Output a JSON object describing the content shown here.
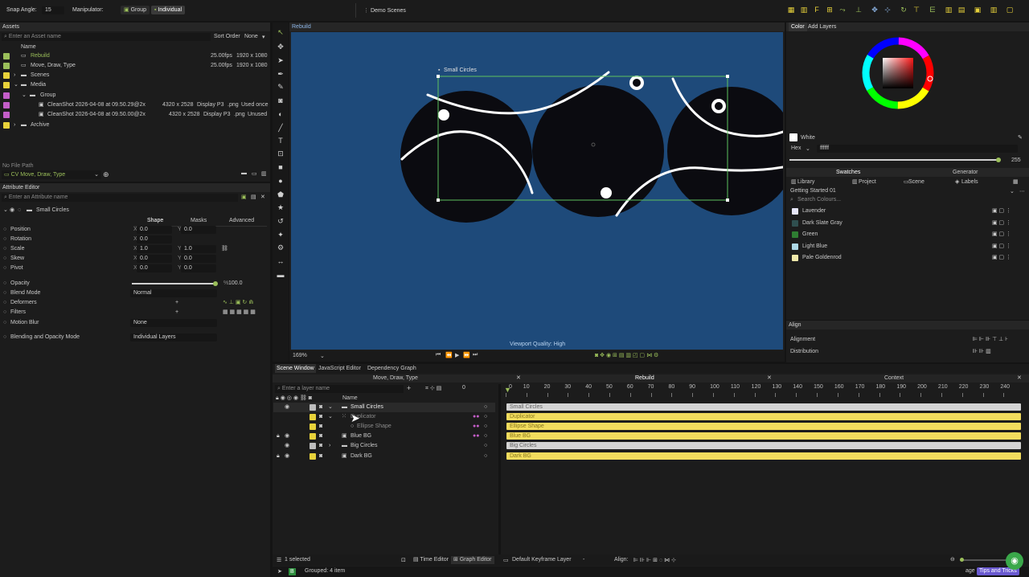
{
  "topbar": {
    "snap_label": "Snap Angle:",
    "snap_value": "15",
    "manipulator_label": "Manipulator:",
    "group_label": "Group",
    "individual_label": "Individual",
    "scene_tab": "Demo Scenes"
  },
  "assets": {
    "title": "Assets",
    "search_placeholder": "Enter an Asset name",
    "sort_label": "Sort Order",
    "sort_value": "None",
    "col_name": "Name",
    "items": [
      {
        "name": "Rebuild",
        "fps": "25.00fps",
        "size": "1920 x 1080",
        "color": "#9bbf5a",
        "active": true
      },
      {
        "name": "Move, Draw, Type",
        "fps": "25.00fps",
        "size": "1920 x 1080",
        "color": "#9bbf5a"
      },
      {
        "name": "Scenes",
        "color": "#e8d23a"
      },
      {
        "name": "Media",
        "color": "#e8d23a"
      },
      {
        "name": "Group",
        "color": "#c45ec8"
      },
      {
        "name": "CleanShot 2026-04-08 at 09.50.29@2x",
        "dims": "4320 x 2528",
        "profile": "Display P3",
        "ext": ".png",
        "usage": "Used once",
        "color": "#c45ec8"
      },
      {
        "name": "CleanShot 2026-04-08 at 09.50.00@2x",
        "dims": "4320 x 2528",
        "profile": "Display P3",
        "ext": ".png",
        "usage": "Unused",
        "color": "#c45ec8"
      },
      {
        "name": "Archive",
        "color": "#e8d23a"
      }
    ],
    "file_path_label": "No File Path",
    "current_scene": "CV Move, Draw, Type"
  },
  "attributes": {
    "title": "Attribute Editor",
    "search_placeholder": "Enter an Attribute name",
    "layer_name": "Small Circles",
    "tabs": [
      "Shape",
      "Masks",
      "Advanced"
    ],
    "props": [
      {
        "label": "Position",
        "x": "0.0",
        "y": "0.0"
      },
      {
        "label": "Rotation",
        "x": "0.0"
      },
      {
        "label": "Scale",
        "x": "1.0",
        "y": "1.0"
      },
      {
        "label": "Skew",
        "x": "0.0",
        "y": "0.0"
      },
      {
        "label": "Pivot",
        "x": "0.0",
        "y": "0.0"
      }
    ],
    "opacity_label": "Opacity",
    "opacity_value": "100.0",
    "opacity_pct": "%",
    "blend_label": "Blend Mode",
    "blend_value": "Normal",
    "deformers_label": "Deformers",
    "filters_label": "Filters",
    "motion_blur_label": "Motion Blur",
    "motion_blur_value": "None",
    "blending_label": "Blending and Opacity Mode",
    "blending_value": "Individual Layers",
    "axis_x": "X",
    "axis_y": "Y"
  },
  "viewport": {
    "tab": "Rebuild",
    "selection_label": "Small Circles",
    "quality": "Viewport Quality: High",
    "zoom": "169%"
  },
  "color": {
    "tabs": [
      "Color",
      "Add Layers"
    ],
    "swatch_name": "White",
    "hex_label": "Hex",
    "hex_value": "ffffff",
    "alpha_value": "255",
    "sub_tabs": [
      "Swatches",
      "Generator"
    ],
    "lib_tabs": [
      "Library",
      "Project",
      "Scene",
      "Labels"
    ],
    "collection": "Getting Started 01",
    "search_placeholder": "Search Colours...",
    "swatches": [
      {
        "name": "Lavender",
        "color": "#e6e6fa"
      },
      {
        "name": "Dark Slate Gray",
        "color": "#2f4f4f"
      },
      {
        "name": "Green",
        "color": "#2e7d32"
      },
      {
        "name": "Light Blue",
        "color": "#add8e6"
      },
      {
        "name": "Pale Goldenrod",
        "color": "#eee8aa"
      }
    ]
  },
  "align": {
    "title": "Align",
    "alignment_label": "Alignment",
    "distribution_label": "Distribution"
  },
  "scene_window": {
    "tabs": [
      "Scene Window",
      "JavaScript Editor",
      "Dependency Graph"
    ],
    "scene_tabs": [
      "Move, Draw, Type",
      "Rebuild",
      "Context"
    ],
    "layer_search_placeholder": "Enter a layer name",
    "frame_value": "0",
    "col_name": "Name",
    "layers": [
      {
        "name": "Small Circles",
        "color": "#bdbdbd"
      },
      {
        "name": "Duplicator",
        "color": "#e8d23a",
        "dim": true
      },
      {
        "name": "Ellipse Shape",
        "color": "#e8d23a",
        "dim": true
      },
      {
        "name": "Blue BG",
        "color": "#e8d23a"
      },
      {
        "name": "Big Circles",
        "color": "#bdbdbd"
      },
      {
        "name": "Dark BG",
        "color": "#e8d23a"
      }
    ],
    "ruler_ticks": [
      "0",
      "10",
      "20",
      "30",
      "40",
      "50",
      "60",
      "70",
      "80",
      "90",
      "100",
      "110",
      "120",
      "130",
      "140",
      "150",
      "160",
      "170",
      "180",
      "190",
      "200",
      "210",
      "220",
      "230",
      "240"
    ],
    "tracks": [
      {
        "name": "Small Circles",
        "color": "#d4d4d4"
      },
      {
        "name": "Duplicator",
        "color": "#f2dc5d"
      },
      {
        "name": "Ellipse Shape",
        "color": "#f2dc5d"
      },
      {
        "name": "Blue BG",
        "color": "#f2dc5d"
      },
      {
        "name": "Big Circles",
        "color": "#d4d4d4"
      },
      {
        "name": "Dark BG",
        "color": "#f2dc5d"
      }
    ],
    "selected_count": "1 selected",
    "time_editor": "Time Editor",
    "graph_editor": "Graph Editor",
    "keyframe_layer": "Default Keyframe Layer",
    "align_label": "Align:"
  },
  "status": {
    "grouped": "Grouped: 4 item",
    "tips_partial": "age",
    "tips": "Tips and Tricks"
  }
}
